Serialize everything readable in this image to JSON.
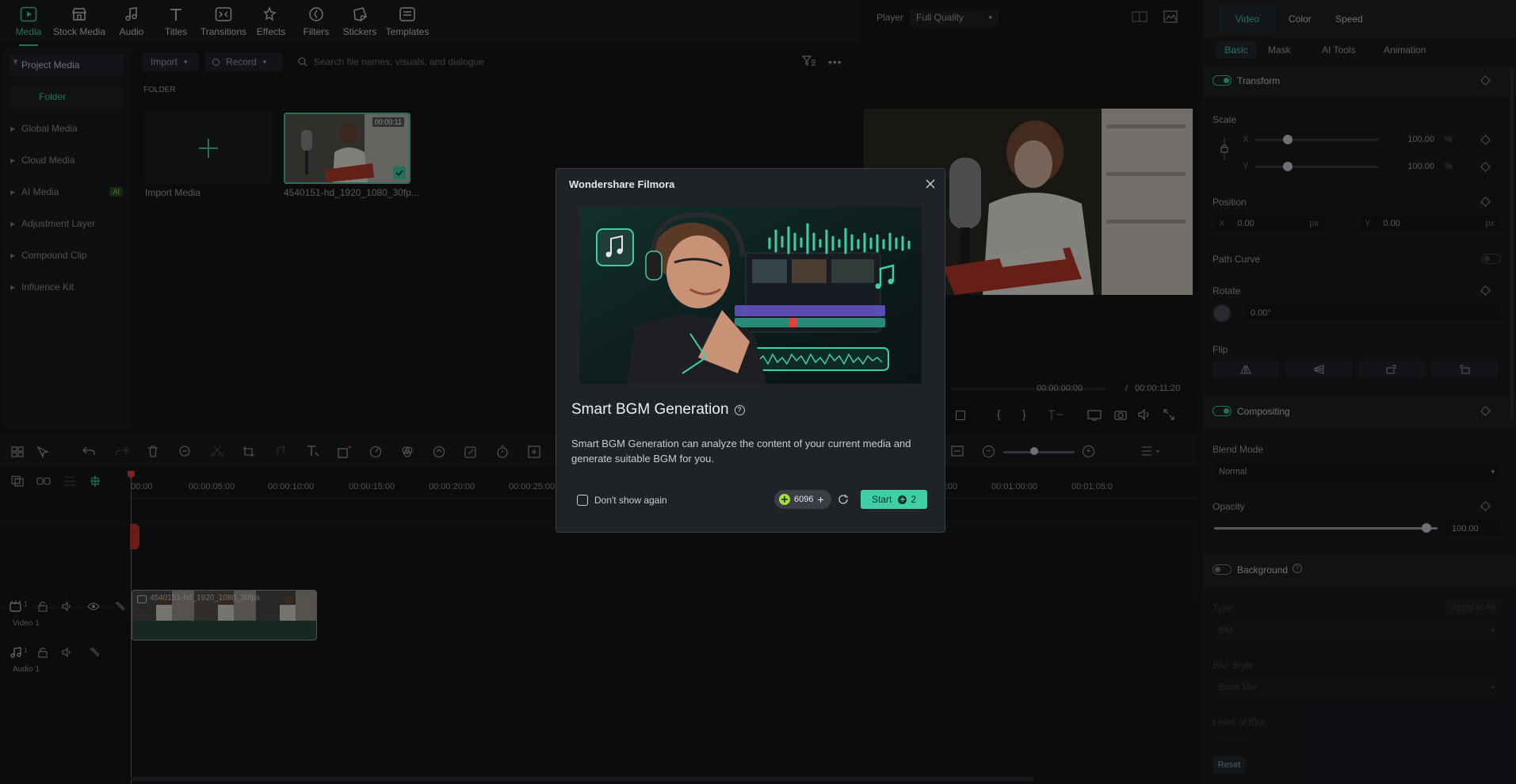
{
  "toolbar": {
    "items": [
      {
        "label": "Media",
        "icon": "media-icon"
      },
      {
        "label": "Stock Media",
        "icon": "stock-media-icon"
      },
      {
        "label": "Audio",
        "icon": "audio-icon"
      },
      {
        "label": "Titles",
        "icon": "titles-icon"
      },
      {
        "label": "Transitions",
        "icon": "transitions-icon"
      },
      {
        "label": "Effects",
        "icon": "effects-icon"
      },
      {
        "label": "Filters",
        "icon": "filters-icon"
      },
      {
        "label": "Stickers",
        "icon": "stickers-icon"
      },
      {
        "label": "Templates",
        "icon": "templates-icon"
      }
    ]
  },
  "nav": {
    "items": [
      {
        "label": "Project Media"
      },
      {
        "label": "Folder"
      },
      {
        "label": "Global Media"
      },
      {
        "label": "Cloud Media"
      },
      {
        "label": "AI Media",
        "badge": "AI"
      },
      {
        "label": "Adjustment Layer"
      },
      {
        "label": "Compound Clip"
      },
      {
        "label": "Influence Kit"
      }
    ]
  },
  "library": {
    "import_label": "Import",
    "record_label": "Record",
    "search_placeholder": "Search file names, visuals, and dialogue",
    "folder_heading": "FOLDER",
    "import_media_label": "Import Media",
    "clip_name": "4540151-hd_1920_1080_30fp...",
    "clip_duration": "00:00:11"
  },
  "player": {
    "label": "Player",
    "quality": "Full Quality",
    "current_time": "00:00:00:00",
    "separator": "/",
    "total_time": "00:00:11:20"
  },
  "props": {
    "tabs": [
      "Video",
      "Color",
      "Speed"
    ],
    "subtabs": [
      "Basic",
      "Mask",
      "AI Tools",
      "Animation"
    ],
    "transform_label": "Transform",
    "scale_label": "Scale",
    "x_label": "X",
    "y_label": "Y",
    "scale_x": "100.00",
    "scale_y": "100.00",
    "percent": "%",
    "position_label": "Position",
    "pos_x": "0.00",
    "pos_y": "0.00",
    "px": "px",
    "path_curve_label": "Path Curve",
    "rotate_label": "Rotate",
    "rotate_value": "0.00°",
    "flip_label": "Flip",
    "compositing_label": "Compositing",
    "blend_mode_label": "Blend Mode",
    "blend_mode_value": "Normal",
    "opacity_label": "Opacity",
    "opacity_value": "100.00",
    "background_label": "Background",
    "type_label": "Type",
    "apply_all_label": "Apply to All",
    "type_value": "Blur",
    "blur_style_label": "Blur Style",
    "blur_style_value": "Basic blur",
    "level_label": "Level of Blur",
    "reset_label": "Reset"
  },
  "timeline": {
    "ruler": [
      "00:00",
      "00:00:05:00",
      "00:00:10:00",
      "00:00:15:00",
      "00:00:20:00",
      "00:00:25:00",
      "00:00:55:00",
      "00:01:00:00",
      "00:01:05:0"
    ],
    "video_track_label": "Video 1",
    "audio_track_label": "Audio 1",
    "track_number": "1",
    "clip_label": "4540151-hd_1920_1080_30fps"
  },
  "dialog": {
    "title": "Wondershare Filmora",
    "heading": "Smart BGM Generation",
    "description": "Smart BGM Generation can analyze the content of your current media and generate suitable BGM for you.",
    "dont_show_label": "Don't show again",
    "credits": "6096",
    "start_label": "Start",
    "start_cost": "2"
  },
  "colors": {
    "accent": "#3ecfa6",
    "dialog_bg": "#1f2226",
    "panel_bg": "#1a1c20",
    "app_bg": "#141619"
  }
}
